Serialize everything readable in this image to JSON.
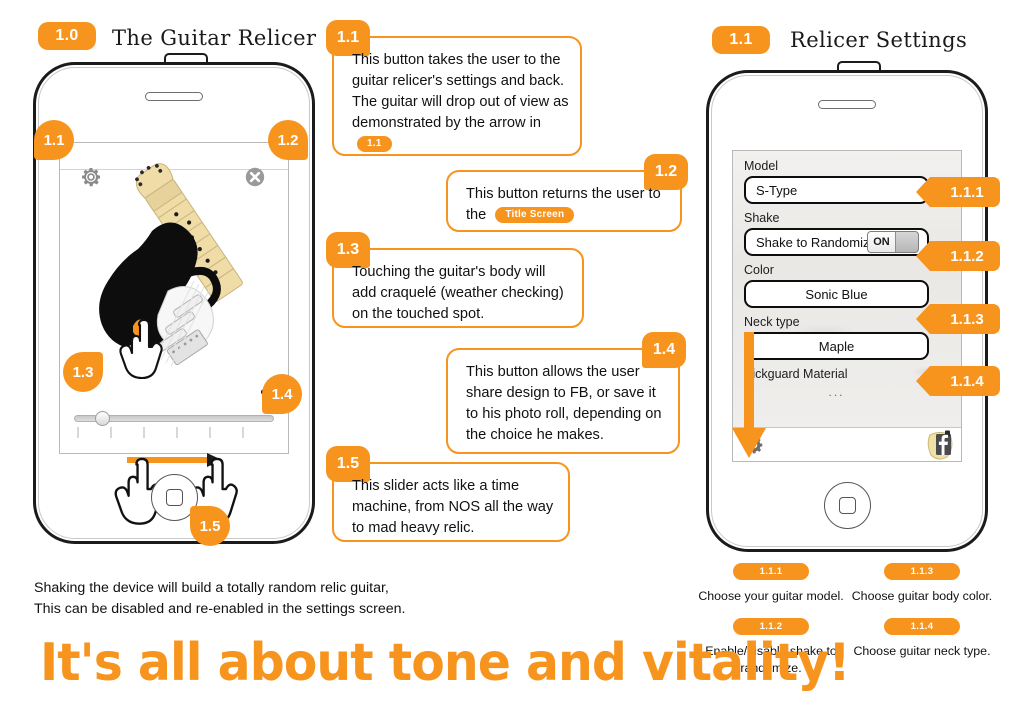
{
  "sections": {
    "left": {
      "number": "1.0",
      "title": "The Guitar Relicer"
    },
    "right": {
      "number": "1.1",
      "title": "Relicer Settings"
    }
  },
  "callouts": [
    {
      "id": "1.1",
      "text": "This button takes the user to the guitar relicer's settings and back. The guitar will drop out of view as demonstrated by the arrow in ",
      "tag": "1.1"
    },
    {
      "id": "1.2",
      "text": "This button returns the user to the ",
      "tag": "Title Screen"
    },
    {
      "id": "1.3",
      "text": "Touching the guitar's body will add craquelé (weather checking) on the touched spot.",
      "tag": ""
    },
    {
      "id": "1.4",
      "text": "This button allows the user share design to FB, or save it to his photo roll, depending on the choice he makes.",
      "tag": ""
    },
    {
      "id": "1.5",
      "text": "This slider acts like a time machine, from NOS all the way to mad heavy relic.",
      "tag": ""
    }
  ],
  "left_phone": {
    "markers": [
      {
        "id": "1.1",
        "icon": "gear-icon"
      },
      {
        "id": "1.2",
        "icon": "close-x-icon"
      },
      {
        "id": "1.3",
        "icon": "touch-hand-icon"
      },
      {
        "id": "1.4",
        "icon": "share-icon"
      },
      {
        "id": "1.5",
        "icon": "drag-hands-icon"
      }
    ]
  },
  "settings": {
    "rows": [
      {
        "label": "Model",
        "value": "S-Type",
        "align": "left",
        "badge": "1.1.1",
        "control": "text"
      },
      {
        "label": "Shake",
        "value": "Shake to Randomize",
        "align": "left",
        "badge": "1.1.2",
        "control": "toggle",
        "toggle_state": "ON"
      },
      {
        "label": "Color",
        "value": "Sonic Blue",
        "align": "center",
        "badge": "1.1.3",
        "control": "text"
      },
      {
        "label": "Neck type",
        "value": "Maple",
        "align": "center",
        "badge": "1.1.4",
        "control": "text"
      },
      {
        "label": "Pickguard Material",
        "value": "...",
        "align": "center",
        "badge": "",
        "control": "plain"
      }
    ],
    "toolbar": {
      "left_icon": "gear-icon",
      "right_icon": "facebook-icon"
    }
  },
  "legend": [
    {
      "badge": "1.1.1",
      "text": "Choose your guitar model."
    },
    {
      "badge": "1.1.3",
      "text": "Choose guitar body color."
    },
    {
      "badge": "1.1.2",
      "text": "Enable/disable shake to randomize."
    },
    {
      "badge": "1.1.4",
      "text": "Choose guitar neck type."
    }
  ],
  "notes": {
    "line1": "Shaking the device will build a totally random relic guitar,",
    "line2": "This can be disabled and re-enabled in the settings screen."
  },
  "headline": "It's all about tone and vitality!",
  "colors": {
    "accent": "#F7941E",
    "ink": "#111111"
  }
}
